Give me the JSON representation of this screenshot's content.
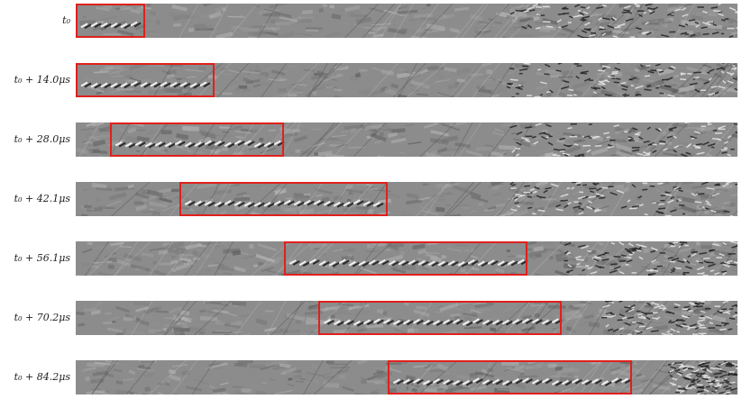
{
  "figure": {
    "rows": [
      {
        "label": "t₀",
        "roi_start": 0.0,
        "roi_end": 0.105
      },
      {
        "label": "t₀ + 14.0μs",
        "roi_start": 0.0,
        "roi_end": 0.21
      },
      {
        "label": "t₀ + 28.0μs",
        "roi_start": 0.052,
        "roi_end": 0.315
      },
      {
        "label": "t₀ + 42.1μs",
        "roi_start": 0.157,
        "roi_end": 0.472
      },
      {
        "label": "t₀ + 56.1μs",
        "roi_start": 0.315,
        "roi_end": 0.683
      },
      {
        "label": "t₀ + 70.2μs",
        "roi_start": 0.367,
        "roi_end": 0.735
      },
      {
        "label": "t₀ + 84.2μs",
        "roi_start": 0.472,
        "roi_end": 0.84
      }
    ],
    "colors": {
      "background": "#ffffff",
      "strip_base": "#8c8c8c",
      "roi_box": "#e0201c",
      "label_text": "#222222"
    }
  }
}
